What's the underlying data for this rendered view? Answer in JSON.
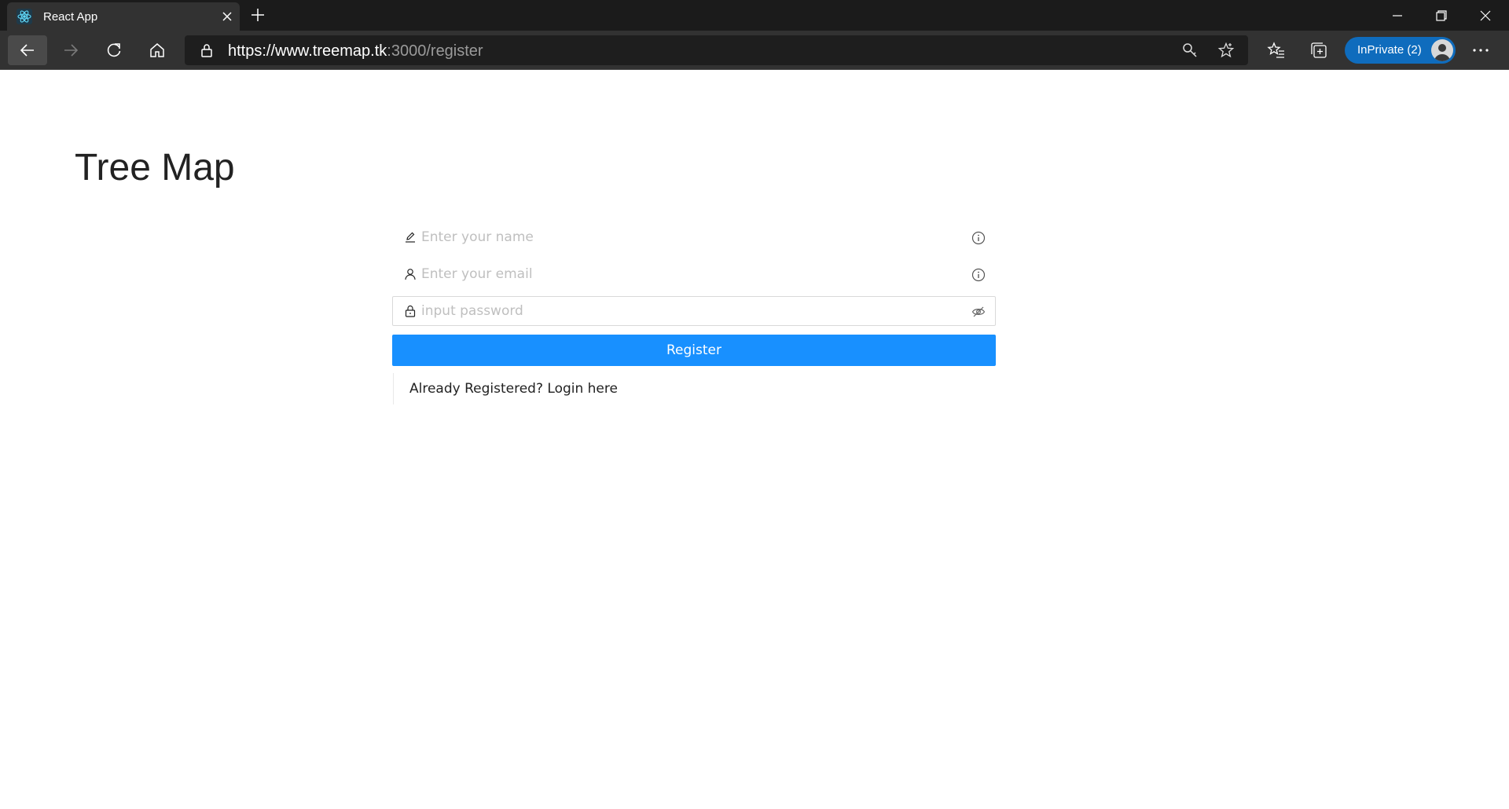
{
  "browser": {
    "tab_title": "React App",
    "url_host": "https://www.treemap.tk",
    "url_path": ":3000/register",
    "inprivate_label": "InPrivate (2)",
    "accent_color": "#0f6cbd"
  },
  "page": {
    "title": "Tree Map"
  },
  "form": {
    "name_placeholder": "Enter your name",
    "email_placeholder": "Enter your email",
    "password_placeholder": "input password",
    "register_label": "Register",
    "login_link": "Already Registered? Login here",
    "primary_color": "#1890ff"
  },
  "icons": {
    "name_prefix": "edit-icon",
    "email_prefix": "user-icon",
    "password_prefix": "lock-icon",
    "info_suffix": "info-circle-icon",
    "password_suffix": "eye-invisible-icon"
  }
}
